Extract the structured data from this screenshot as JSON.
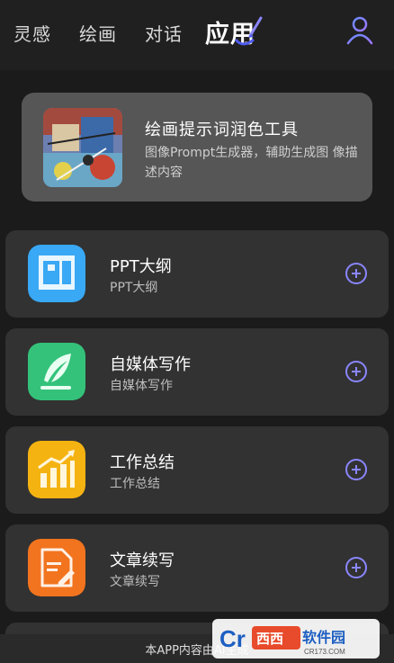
{
  "nav": {
    "tabs": [
      "灵感",
      "绘画",
      "对话",
      "应用"
    ],
    "active_tab": "应用",
    "user_icon": "user-icon",
    "accent_color": "#8a86ff"
  },
  "featured": {
    "title": "绘画提示词润色工具",
    "description": "图像Prompt生成器，辅助生成图 像描述内容"
  },
  "apps": [
    {
      "title": "PPT大纲",
      "subtitle": "PPT大纲",
      "icon": "ppt-icon",
      "color": "#39a8f5"
    },
    {
      "title": "自媒体写作",
      "subtitle": "自媒体写作",
      "icon": "feather-icon",
      "color": "#34c27a"
    },
    {
      "title": "工作总结",
      "subtitle": "工作总结",
      "icon": "chart-icon",
      "color": "#f5b312"
    },
    {
      "title": "文章续写",
      "subtitle": "文章续写",
      "icon": "document-edit-icon",
      "color": "#f2741f"
    }
  ],
  "footer": {
    "text": "本APP内容由AI生成"
  },
  "watermark": {
    "text": "Cr西西软件园",
    "sub": "CR173.COM"
  }
}
